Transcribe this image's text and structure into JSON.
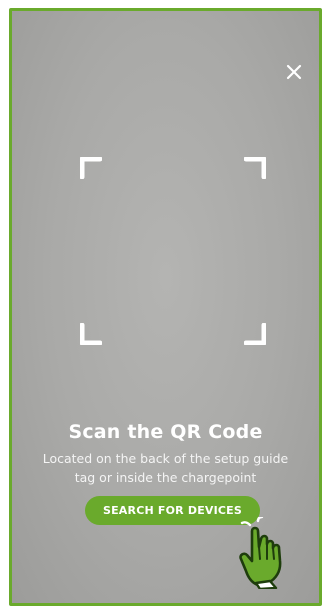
{
  "scanner": {
    "title": "Scan the QR Code",
    "subtitle_line1": "Located on the back of the setup guide",
    "subtitle_line2": "tag or inside the chargepoint",
    "search_button_label": "SEARCH FOR DEVICES"
  },
  "icons": {
    "close": "close-icon",
    "viewfinder": "viewfinder-corner",
    "pointer": "hand-pointer-icon"
  },
  "colors": {
    "accent": "#6aaa2c",
    "accent_dark": "#3f7d17",
    "text": "#ffffff"
  }
}
